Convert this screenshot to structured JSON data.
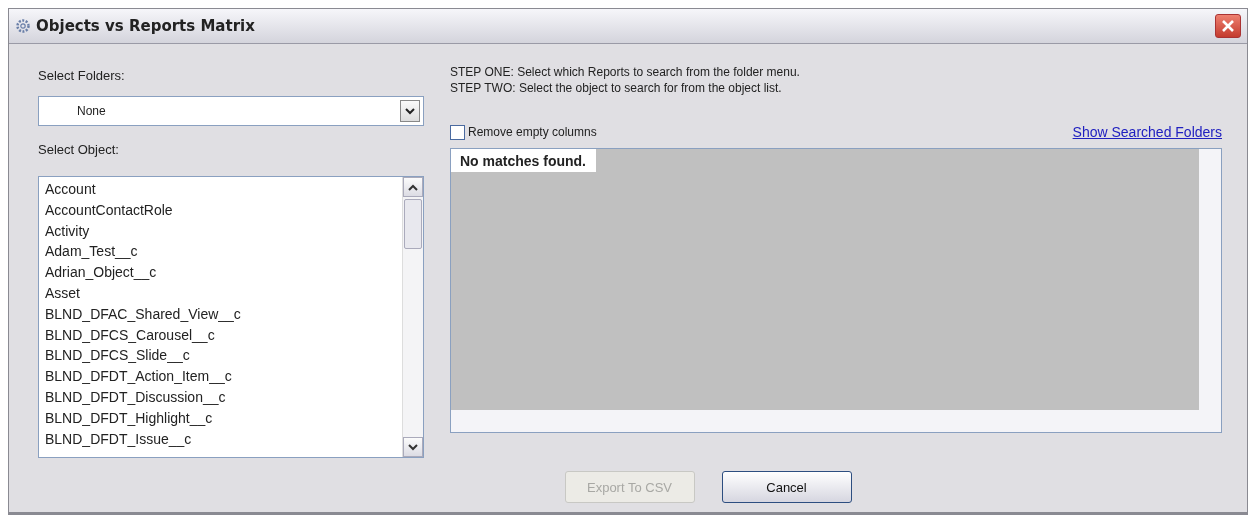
{
  "window": {
    "title": "Objects vs Reports Matrix"
  },
  "folders": {
    "label": "Select Folders:",
    "value": "None"
  },
  "objects": {
    "label": "Select Object:",
    "items": [
      {
        "label": "Account",
        "selected": false
      },
      {
        "label": "AccountContactRole",
        "selected": false
      },
      {
        "label": "Activity",
        "selected": false
      },
      {
        "label": "Adam_Test__c",
        "selected": false
      },
      {
        "label": "Adrian_Object__c",
        "selected": false
      },
      {
        "label": "Asset",
        "selected": false
      },
      {
        "label": "BLND_DFAC_Shared_View__c",
        "selected": false
      },
      {
        "label": "BLND_DFCS_Carousel__c",
        "selected": false
      },
      {
        "label": "BLND_DFCS_Slide__c",
        "selected": false
      },
      {
        "label": "BLND_DFDT_Action_Item__c",
        "selected": false
      },
      {
        "label": "BLND_DFDT_Discussion__c",
        "selected": false
      },
      {
        "label": "BLND_DFDT_Highlight__c",
        "selected": false
      },
      {
        "label": "BLND_DFDT_Issue__c",
        "selected": false
      }
    ]
  },
  "instructions": [
    "STEP ONE: Select which Reports to search from the folder menu.",
    "STEP TWO: Select the object to search for from the object list."
  ],
  "remove_empty_columns": {
    "label": "Remove empty columns",
    "checked": false
  },
  "show_searched_folders": "Show Searched Folders",
  "results": {
    "message": "No matches found."
  },
  "buttons": [
    {
      "label": "Export To CSV",
      "disabled": true
    },
    {
      "label": "Cancel",
      "disabled": false
    }
  ]
}
